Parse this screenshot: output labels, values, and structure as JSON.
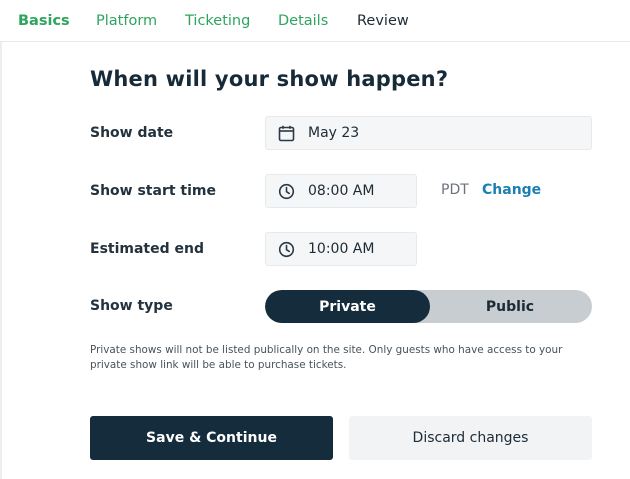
{
  "tabs": [
    {
      "label": "Basics",
      "state": "active"
    },
    {
      "label": "Platform",
      "state": "done"
    },
    {
      "label": "Ticketing",
      "state": "done"
    },
    {
      "label": "Details",
      "state": "done"
    },
    {
      "label": "Review",
      "state": "upcoming"
    }
  ],
  "form": {
    "heading": "When will your show happen?",
    "show_date": {
      "label": "Show date",
      "value": "May 23",
      "icon": "calendar-icon"
    },
    "start_time": {
      "label": "Show start time",
      "value": "08:00 AM",
      "icon": "clock-icon",
      "timezone": "PDT",
      "change_label": "Change"
    },
    "end_time": {
      "label": "Estimated end",
      "value": "10:00 AM",
      "icon": "clock-icon"
    },
    "show_type": {
      "label": "Show type",
      "options": [
        "Private",
        "Public"
      ],
      "selected": "Private"
    },
    "note": "Private shows will not be listed publically on the site. Only guests who have access to your private show link will be able to purchase tickets."
  },
  "actions": {
    "save_label": "Save & Continue",
    "discard_label": "Discard changes"
  },
  "colors": {
    "accent_green": "#2fa45f",
    "dark_navy": "#152c3d",
    "link_blue": "#1b7fb3"
  }
}
